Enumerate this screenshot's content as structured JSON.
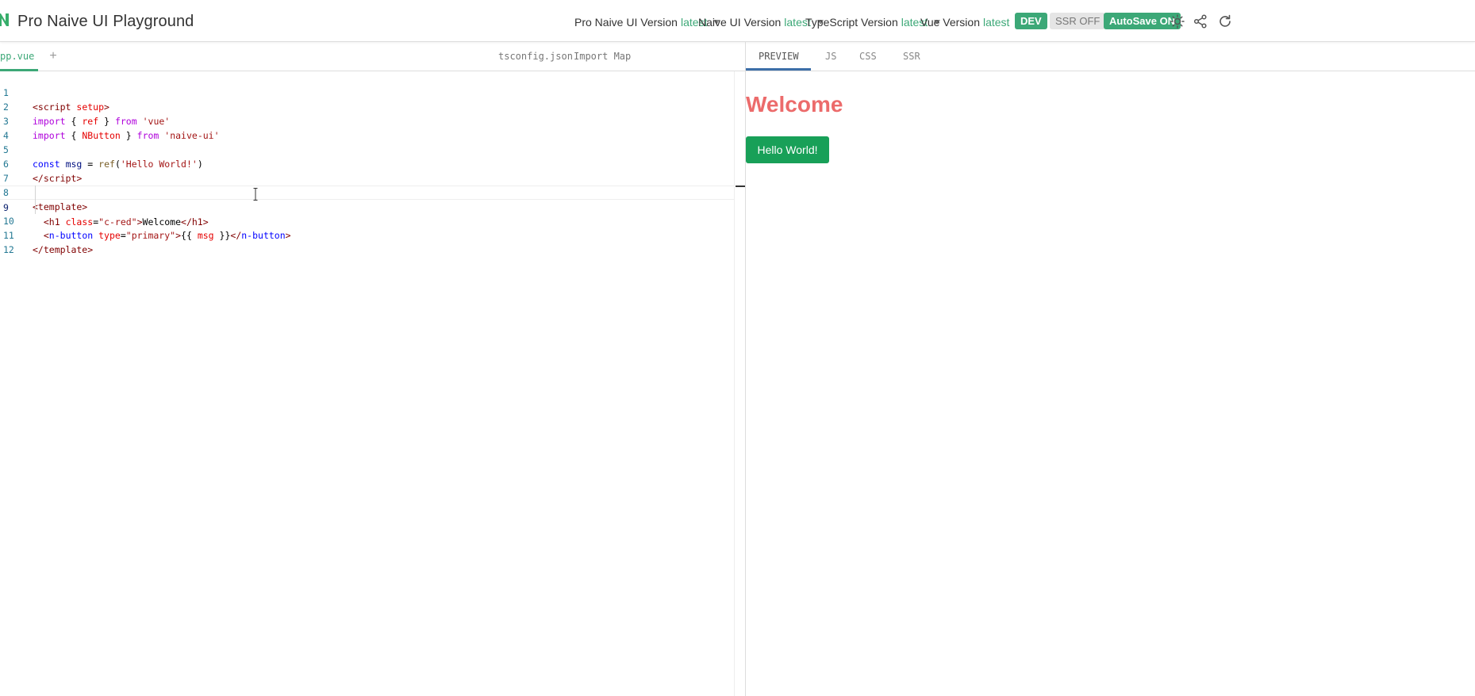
{
  "header": {
    "title": "Pro Naive UI Playground",
    "versions": [
      {
        "label": "Pro Naive UI Version",
        "value": "latest"
      },
      {
        "label": "Naive UI Version",
        "value": "latest"
      },
      {
        "label": "TypeScript Version",
        "value": "latest"
      },
      {
        "label": "Vue Version",
        "value": "latest"
      }
    ],
    "dev_badge": "DEV",
    "ssr_badge": "SSR OFF",
    "autosave_badge": "AutoSave ON",
    "icons": [
      "theme-toggle-icon",
      "share-icon",
      "reload-icon"
    ],
    "accent_color": "#3ca877"
  },
  "editor": {
    "active_file": "pp.vue",
    "add_label": "+",
    "right_tabs": [
      "tsconfig.json",
      "Import Map"
    ],
    "line_numbers": [
      "1",
      "2",
      "3",
      "4",
      "5",
      "6",
      "7",
      "8",
      "9",
      "10",
      "11",
      "12"
    ],
    "active_line": "9"
  },
  "preview": {
    "tabs": [
      "PREVIEW",
      "JS",
      "CSS",
      "SSR"
    ],
    "active_tab": "PREVIEW",
    "heading": "Welcome",
    "button_label": "Hello World!",
    "heading_color": "#ec6b6b",
    "button_color": "#18a058"
  }
}
